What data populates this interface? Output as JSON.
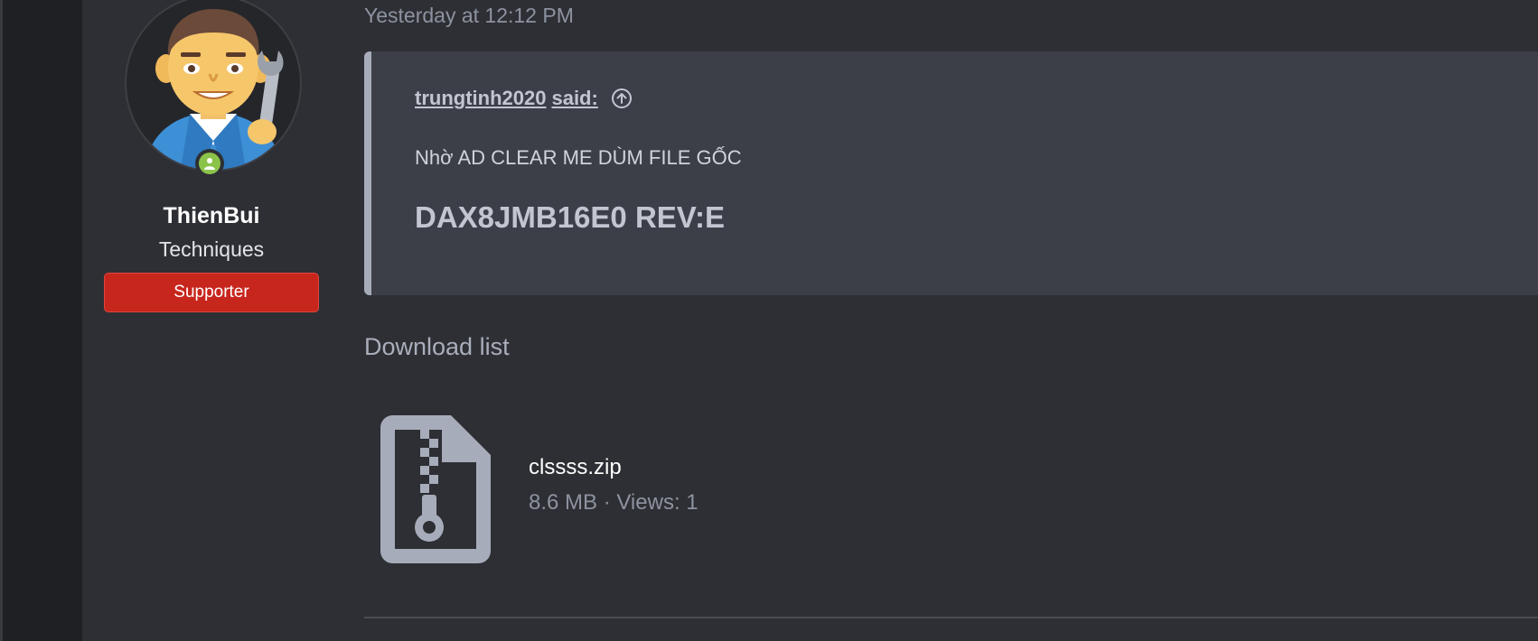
{
  "user": {
    "name": "ThienBui",
    "title": "Techniques",
    "banner": "Supporter",
    "online": true,
    "avatar_icon": "man-mechanic-avatar"
  },
  "post": {
    "date": "Yesterday at 12:12 PM",
    "quote": {
      "author": "trungtinh2020",
      "said_suffix": "said:",
      "jump_icon": "arrow-up-circle-icon",
      "line1": "Nhờ AD CLEAR ME DÙM FILE GỐC",
      "line2": "DAX8JMB16E0 REV:E"
    }
  },
  "downloads": {
    "heading": "Download list",
    "files": [
      {
        "icon": "zip-file-icon",
        "name": "clssss.zip",
        "meta": "8.6 MB · Views: 1"
      }
    ]
  },
  "colors": {
    "background": "#2e2f34",
    "gutter": "#1f2024",
    "quote_bg": "#3d3f48",
    "quote_border": "#a7acba",
    "banner": "#c7261d",
    "online": "#8bc34a",
    "muted_text": "#8d92a0"
  }
}
